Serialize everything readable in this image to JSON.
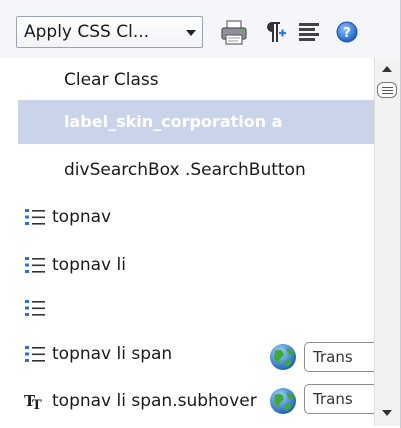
{
  "toolbar": {
    "dropdown_label": "Apply CSS Cl...",
    "buttons": [
      {
        "icon": "print-preview-icon"
      },
      {
        "icon": "paragraph-icon"
      },
      {
        "icon": "align-text-icon"
      },
      {
        "icon": "help-icon"
      }
    ]
  },
  "list": {
    "items": [
      {
        "label": "Clear Class",
        "selected": false
      },
      {
        "label": "label_skin_corporation a",
        "selected": true
      },
      {
        "label": "divSearchBox .SearchButton",
        "selected": false
      },
      {
        "label": "topnav",
        "icon": "list-style-icon"
      },
      {
        "label": "topnav li",
        "icon": "list-style-icon"
      },
      {
        "label": "",
        "icon": "list-style-icon"
      },
      {
        "label": "topnav li span",
        "icon": "list-style-icon"
      },
      {
        "label": "topnav li span.subhover",
        "icon": "font-style-icon"
      }
    ],
    "overlays": [
      {
        "icon": "globe-icon",
        "text": "Trans"
      },
      {
        "icon": "globe-icon",
        "text": "Trans"
      }
    ]
  },
  "colors": {
    "selection": "#c9d4ea",
    "toolbar_bg": "#f4f6fa"
  }
}
